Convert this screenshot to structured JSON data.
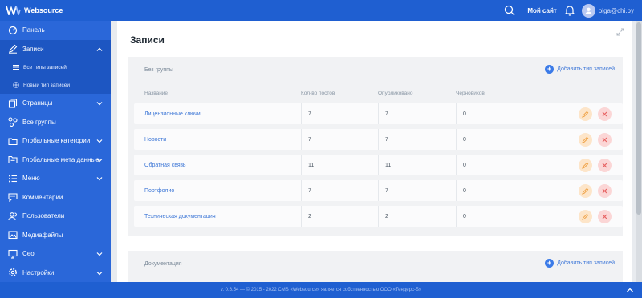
{
  "app": {
    "brand": "Websource"
  },
  "topbar": {
    "my_site": "Мой сайт",
    "user": "olga@chi.by"
  },
  "sidebar": {
    "items": [
      {
        "label": "Панель"
      },
      {
        "label": "Записи"
      },
      {
        "label": "Все типы записей"
      },
      {
        "label": "Новый тип записей"
      },
      {
        "label": "Страницы"
      },
      {
        "label": "Все группы"
      },
      {
        "label": "Глобальные категории"
      },
      {
        "label": "Глобальные мета данные"
      },
      {
        "label": "Меню"
      },
      {
        "label": "Комментарии"
      },
      {
        "label": "Пользователи"
      },
      {
        "label": "Медиафайлы"
      },
      {
        "label": "Сео"
      },
      {
        "label": "Настройки"
      }
    ]
  },
  "main": {
    "title": "Записи",
    "groups": [
      {
        "title": "Без группы",
        "add_label": "Добавить тип записей",
        "columns": [
          "Название",
          "Кол-во постов",
          "Опубликовано",
          "Черновиков"
        ],
        "rows": [
          {
            "name": "Лицензионные ключи",
            "posts": "7",
            "published": "7",
            "drafts": "0"
          },
          {
            "name": "Новости",
            "posts": "7",
            "published": "7",
            "drafts": "0"
          },
          {
            "name": "Обратная связь",
            "posts": "11",
            "published": "11",
            "drafts": "0"
          },
          {
            "name": "Портфолио",
            "posts": "7",
            "published": "7",
            "drafts": "0"
          },
          {
            "name": "Техническая документация",
            "posts": "2",
            "published": "2",
            "drafts": "0"
          }
        ]
      },
      {
        "title": "Документация",
        "add_label": "Добавить тип записей"
      }
    ]
  },
  "footer": {
    "text": "v. 0.6.54 — © 2015 - 2022 CMS «Websource» является собственностью ООО «Тендерс-Б»"
  },
  "colors": {
    "primary": "#1f5fd1",
    "sidebar": "#2a67d9",
    "link": "#3c76d6",
    "edit": "#f0a348",
    "delete": "#e86363"
  }
}
